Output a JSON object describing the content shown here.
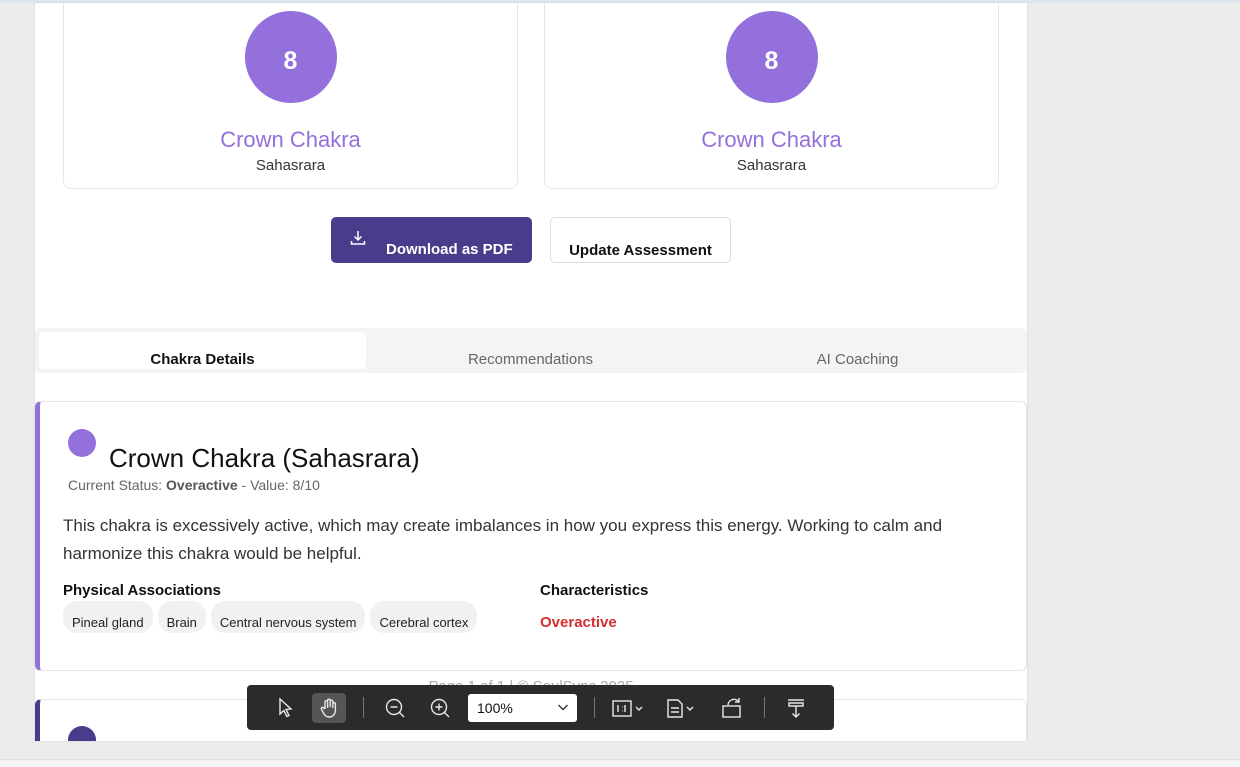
{
  "cards": [
    {
      "value": "8",
      "name": "Crown Chakra",
      "sanskrit": "Sahasrara"
    },
    {
      "value": "8",
      "name": "Crown Chakra",
      "sanskrit": "Sahasrara"
    }
  ],
  "buttons": {
    "download": "Download as PDF",
    "update": "Update Assessment"
  },
  "tabs": [
    "Chakra Details",
    "Recommendations",
    "AI Coaching"
  ],
  "detail": {
    "title": "Crown Chakra (Sahasrara)",
    "status_prefix": "Current Status: ",
    "status": "Overactive",
    "value_text": " - Value: 8/10",
    "description": "This chakra is excessively active, which may create imbalances in how you express this energy. Working to calm and harmonize this chakra would be helpful.",
    "physical_heading": "Physical Associations",
    "physical": [
      "Pineal gland",
      "Brain",
      "Central nervous system",
      "Cerebral cortex"
    ],
    "characteristics_heading": "Characteristics",
    "characteristic": "Overactive"
  },
  "footer": "Page 1 of 1 | © SoulSync 2025",
  "toolbar": {
    "zoom": "100%"
  },
  "colors": {
    "crown": "#9370db",
    "primary": "#483d8b",
    "overactive": "#d32f2f"
  }
}
